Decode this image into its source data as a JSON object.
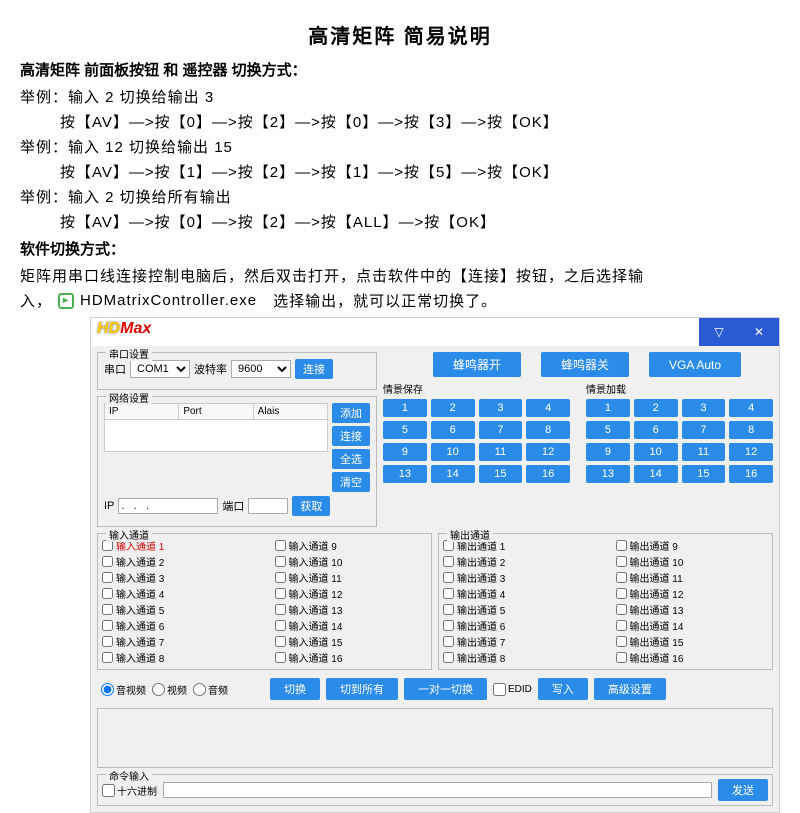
{
  "doc": {
    "title": "高清矩阵 简易说明",
    "h2a": "高清矩阵 前面板按钮 和 遥控器 切换方式：",
    "ex1a": "举例：输入 2 切换给输出 3",
    "ex1b": "按【AV】—>按【0】—>按【2】—>按【0】—>按【3】—>按【OK】",
    "ex2a": "举例：输入 12 切换给输出 15",
    "ex2b": "按【AV】—>按【1】—>按【2】—>按【1】—>按【5】—>按【OK】",
    "ex3a": "举例：输入 2 切换给所有输出",
    "ex3b": "按【AV】—>按【0】—>按【2】—>按【ALL】—>按【OK】",
    "h2b": "软件切换方式：",
    "soft1": "矩阵用串口线连接控制电脑后，然后双击打开，点击软件中的【连接】按钮，之后选择输",
    "soft_in": "入，",
    "exe": "HDMatrixController.exe",
    "soft2": "选择输出，就可以正常切换了。"
  },
  "app": {
    "logo_hd": "HD",
    "logo_max": "Max",
    "win": {
      "min": "▽",
      "close": "✕"
    },
    "serial": {
      "title": "串口设置",
      "port_lbl": "串口",
      "port_val": "COM1",
      "baud_lbl": "波特率",
      "baud_val": "9600",
      "connect": "连接"
    },
    "net": {
      "title": "网络设置",
      "col_ip": "IP",
      "col_port": "Port",
      "col_alias": "Alais",
      "add": "添加",
      "conn": "连接",
      "all": "全选",
      "clear": "清空",
      "ip_lbl": "IP",
      "ip_val": ".   .   .",
      "port_lbl": "端口",
      "port_val": "",
      "get": "获取"
    },
    "top_btns": {
      "buzz_on": "蜂鸣器开",
      "buzz_off": "蜂鸣器关",
      "vga": "VGA Auto"
    },
    "scene_save": "情景保存",
    "scene_load": "情景加载",
    "nums": [
      "1",
      "2",
      "3",
      "4",
      "5",
      "6",
      "7",
      "8",
      "9",
      "10",
      "11",
      "12",
      "13",
      "14",
      "15",
      "16"
    ],
    "in_ch_title": "输入通道",
    "out_ch_title": "输出通道",
    "in_ch_prefix": "输入通道",
    "out_ch_prefix": "输出通道",
    "radios": {
      "av": "音视频",
      "v": "视频",
      "a": "音频"
    },
    "btns": {
      "switch": "切换",
      "switch_all": "切到所有",
      "one_to_one": "一对一切换",
      "edid": "EDID",
      "write": "写入",
      "advanced": "高级设置"
    },
    "cmd": {
      "title": "命令输入",
      "hex": "十六进制",
      "send": "发送"
    }
  }
}
